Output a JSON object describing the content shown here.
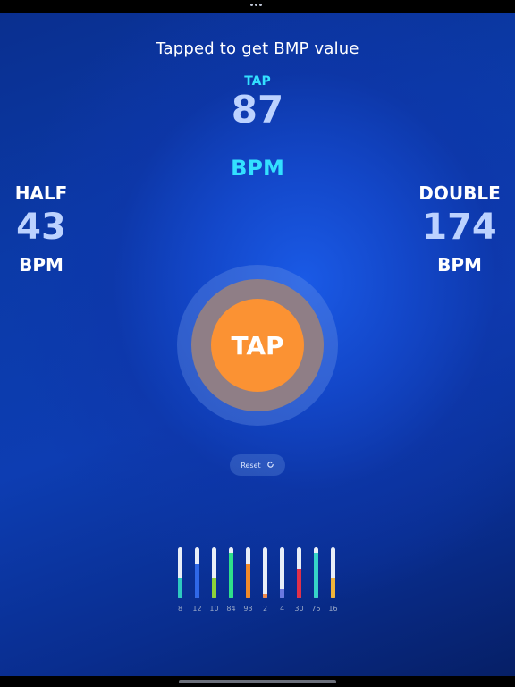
{
  "headline": "Tapped to get BMP value",
  "tap": {
    "label": "TAP",
    "value": "87"
  },
  "bpm_label": "BPM",
  "half": {
    "label": "HALF",
    "value": "43",
    "unit": "BPM"
  },
  "double": {
    "label": "DOUBLE",
    "value": "174",
    "unit": "BPM"
  },
  "tap_button": {
    "label": "TAP"
  },
  "reset": {
    "label": "Reset",
    "icon": "refresh-icon"
  },
  "colors": {
    "accent_cyan": "#33e0ff",
    "tap_orange": "#fb9233",
    "value_blue": "#bcd2ff"
  },
  "meters": [
    {
      "label": "8",
      "level": 0.4,
      "color": "#2ec9c0"
    },
    {
      "label": "12",
      "level": 0.68,
      "color": "#2f68e8"
    },
    {
      "label": "10",
      "level": 0.4,
      "color": "#8cd23a"
    },
    {
      "label": "84",
      "level": 0.9,
      "color": "#2fe08a"
    },
    {
      "label": "93",
      "level": 0.68,
      "color": "#f08a2a"
    },
    {
      "label": "2",
      "level": 0.08,
      "color": "#f08a4a"
    },
    {
      "label": "4",
      "level": 0.18,
      "color": "#6a78e0"
    },
    {
      "label": "30",
      "level": 0.58,
      "color": "#e0304a"
    },
    {
      "label": "75",
      "level": 0.9,
      "color": "#36d4c8"
    },
    {
      "label": "16",
      "level": 0.4,
      "color": "#f0b43a"
    }
  ]
}
